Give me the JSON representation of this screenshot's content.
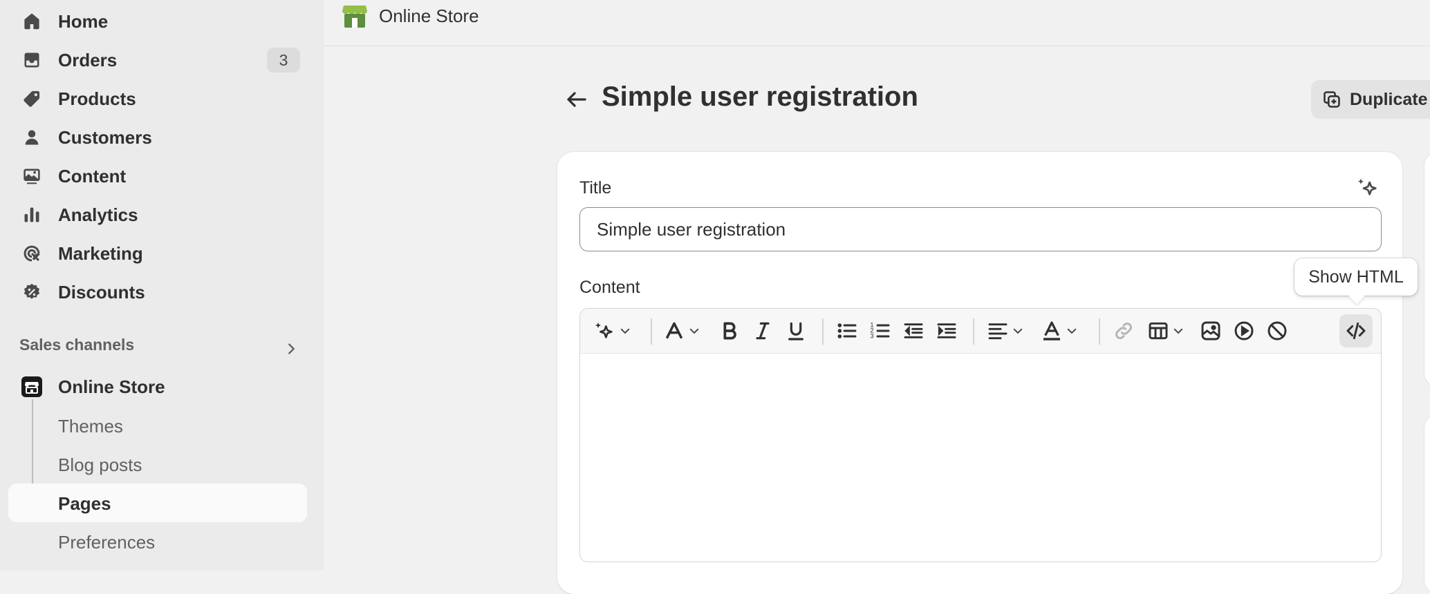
{
  "colors": {
    "sidebar_bg": "#ebebeb",
    "page_bg": "#f1f1f1",
    "text": "#303030",
    "muted": "#616161",
    "active_item_bg": "#fafafa",
    "store_green": "#5f8f3a"
  },
  "sidebar": {
    "nav": [
      {
        "label": "Home",
        "icon": "home-icon"
      },
      {
        "label": "Orders",
        "icon": "inbox-icon",
        "badge": "3"
      },
      {
        "label": "Products",
        "icon": "tag-icon"
      },
      {
        "label": "Customers",
        "icon": "person-icon"
      },
      {
        "label": "Content",
        "icon": "image-icon"
      },
      {
        "label": "Analytics",
        "icon": "bar-chart-icon"
      },
      {
        "label": "Marketing",
        "icon": "target-icon"
      },
      {
        "label": "Discounts",
        "icon": "discount-icon"
      }
    ],
    "sales_channels_title": "Sales channels",
    "online_store": {
      "label": "Online Store",
      "icon": "storefront-icon",
      "sub_items": [
        {
          "label": "Themes"
        },
        {
          "label": "Blog posts"
        },
        {
          "label": "Pages",
          "active": true
        },
        {
          "label": "Preferences"
        }
      ]
    }
  },
  "topbar": {
    "store_name": "Online Store",
    "icon": "online-store-logo-icon"
  },
  "page": {
    "title": "Simple user registration",
    "duplicate_label": "Duplicate"
  },
  "form": {
    "title_label": "Title",
    "title_value": "Simple user registration",
    "content_label": "Content"
  },
  "editor": {
    "toolbar_icons": [
      "magic-icon",
      "font-icon",
      "bold-icon",
      "italic-icon",
      "underline-icon",
      "bullet-list-icon",
      "numbered-list-icon",
      "outdent-icon",
      "indent-icon",
      "align-icon",
      "text-color-icon",
      "link-icon",
      "table-icon",
      "image-icon",
      "video-icon",
      "clear-format-icon",
      "code-icon"
    ],
    "tooltip": "Show HTML"
  }
}
